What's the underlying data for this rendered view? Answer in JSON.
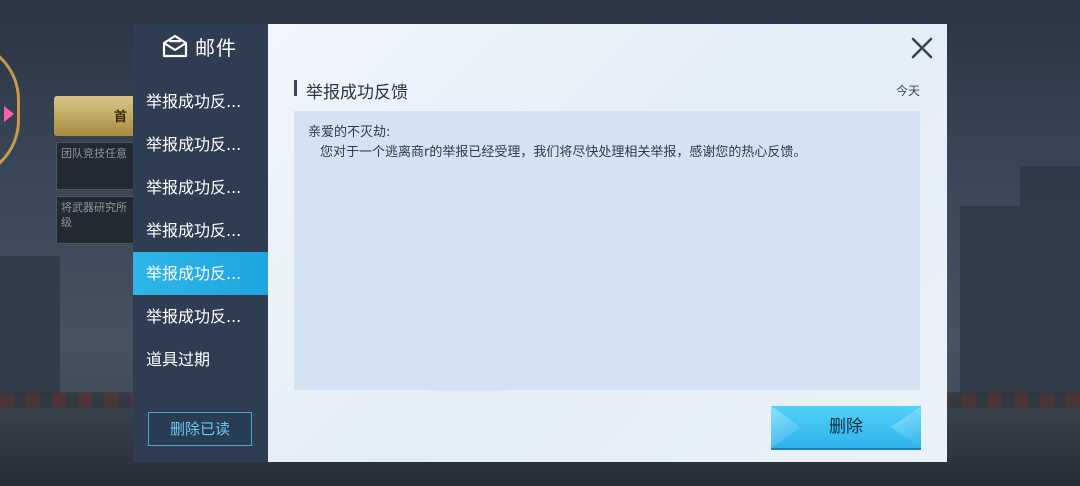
{
  "background": {
    "cards": [
      "团队竞技任意",
      "将武器研究所\n级"
    ],
    "badge_text": "首"
  },
  "sidebar": {
    "title": "邮件",
    "icon": "mail-icon",
    "items": [
      {
        "label": "举报成功反...",
        "active": false
      },
      {
        "label": "举报成功反...",
        "active": false
      },
      {
        "label": "举报成功反...",
        "active": false
      },
      {
        "label": "举报成功反...",
        "active": false
      },
      {
        "label": "举报成功反...",
        "active": true
      },
      {
        "label": "举报成功反...",
        "active": false
      },
      {
        "label": "道具过期",
        "active": false
      }
    ],
    "delete_read_label": "删除已读"
  },
  "message": {
    "title": "举报成功反馈",
    "date": "今天",
    "greeting": "亲爱的不灭劫:",
    "body": "您对于一个逃离商r的举报已经受理，我们将尽快处理相关举报，感谢您的热心反馈。",
    "delete_label": "删除"
  },
  "colors": {
    "sidebar_bg": "#2f3d52",
    "active_item": "#2fb6e8",
    "content_bg": "#eaf2f9",
    "delete_button": "#3fc1f2"
  }
}
